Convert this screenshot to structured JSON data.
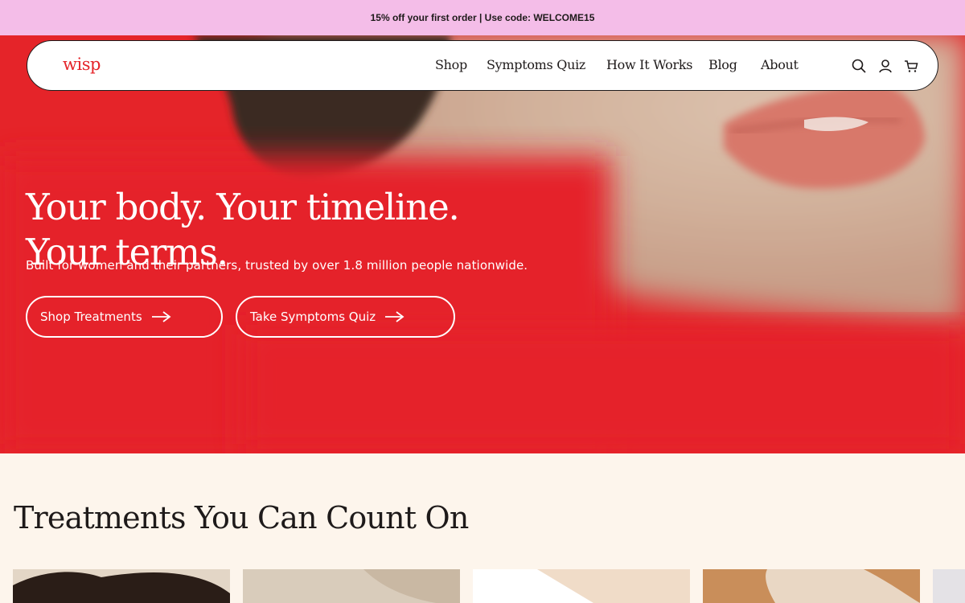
{
  "promo": {
    "text": "15% off your first order | Use code: WELCOME15"
  },
  "nav": {
    "logo": "wisp",
    "links": [
      "Shop",
      "Symptoms Quiz",
      "How It Works",
      "Blog",
      "About"
    ],
    "icons": [
      "search-icon",
      "account-icon",
      "cart-icon"
    ]
  },
  "hero": {
    "title_line1": "Your body. Your timeline.",
    "title_line2": "Your terms.",
    "subtitle": "Built for women and their partners, trusted by over 1.8 million people nationwide.",
    "cta_primary": "Shop Treatments",
    "cta_secondary": "Take Symptoms Quiz"
  },
  "treatments": {
    "title": "Treatments You Can Count On"
  },
  "colors": {
    "brand_red": "#e52429",
    "promo_pink": "#f4bde8",
    "cream": "#fdf5ec",
    "ink": "#1e1a1a"
  }
}
